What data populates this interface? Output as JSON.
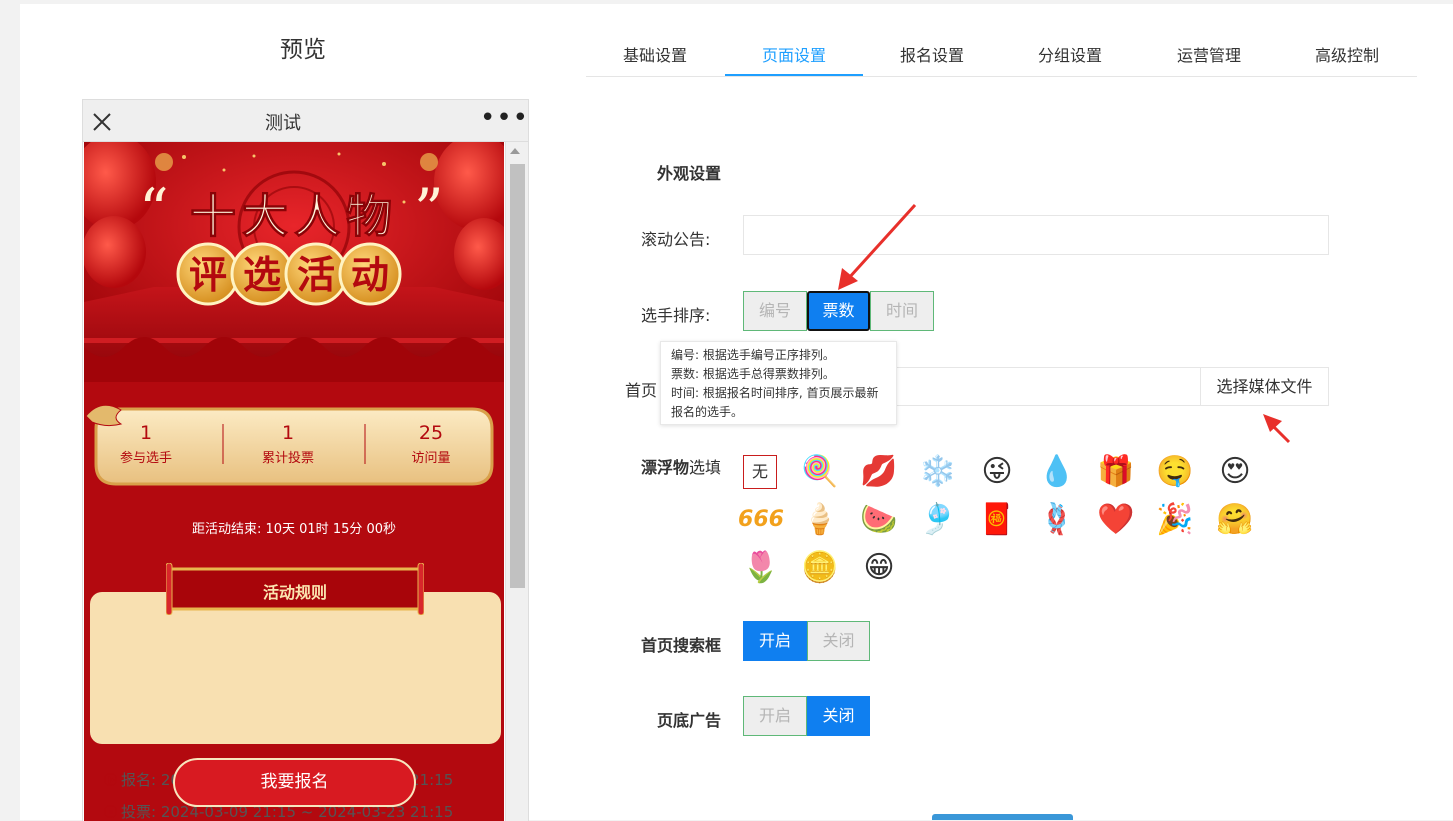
{
  "preview": {
    "heading": "预览",
    "window_title": "测试",
    "more": "•••",
    "stats": [
      {
        "value": "1",
        "label": "参与选手"
      },
      {
        "value": "1",
        "label": "累计投票"
      },
      {
        "value": "25",
        "label": "访问量"
      }
    ],
    "countdown": "距活动结束:  10天 01时 15分 00秒",
    "rules_title": "活动规则",
    "signup_period": "报名: 2024-03-09 21:15 ~ 2024-03-16 21:15",
    "vote_period": "投票: 2024-03-09 21:15 ~ 2024-03-23 21:15",
    "signup_button": "我要报名",
    "banner": {
      "quote_open": "“",
      "line1": "十大人物",
      "quote_close": "”",
      "line2": [
        "评",
        "选",
        "活",
        "动"
      ]
    }
  },
  "tabs": [
    {
      "label": "基础设置",
      "active": false
    },
    {
      "label": "页面设置",
      "active": true
    },
    {
      "label": "报名设置",
      "active": false
    },
    {
      "label": "分组设置",
      "active": false
    },
    {
      "label": "运营管理",
      "active": false
    },
    {
      "label": "高级控制",
      "active": false
    }
  ],
  "form": {
    "section_title": "外观设置",
    "notice_label": "滚动公告:",
    "notice_value": "",
    "sort_label": "选手排序:",
    "sort_options": [
      "编号",
      "票数",
      "时间"
    ],
    "sort_selected": "票数",
    "tooltip_lines": [
      "编号: 根据选手编号正序排列。",
      "票数: 根据选手总得票数排列。",
      "时间: 根据报名时间排序, 首页展示最新报名的选手。"
    ],
    "homepage_label_prefix": "首页",
    "media_button": "选择媒体文件",
    "float_label_bold": "漂浮物",
    "float_label_rest": "选填",
    "float_none": "无",
    "float_items": [
      "🍭",
      "💋",
      "❄️",
      "😜",
      "💧",
      "🎁",
      "🤤",
      "😍",
      "666",
      "🍦",
      "🍉",
      "🎐",
      "🧧",
      "🪢",
      "❤️",
      "🎉",
      "🤗",
      "🌷",
      "🪙",
      "😁"
    ],
    "search_label": "首页搜索框",
    "search_options": [
      "开启",
      "关闭"
    ],
    "search_selected": "开启",
    "footer_ad_label": "页底广告",
    "footer_ad_options": [
      "开启",
      "关闭"
    ],
    "footer_ad_selected": "关闭"
  },
  "colors": {
    "accent": "#1e9fff",
    "toggle_on": "#0f7ff0",
    "toggle_border": "#5fb878",
    "festival_red": "#b3090f",
    "annotation_arrow": "#e8302b"
  }
}
